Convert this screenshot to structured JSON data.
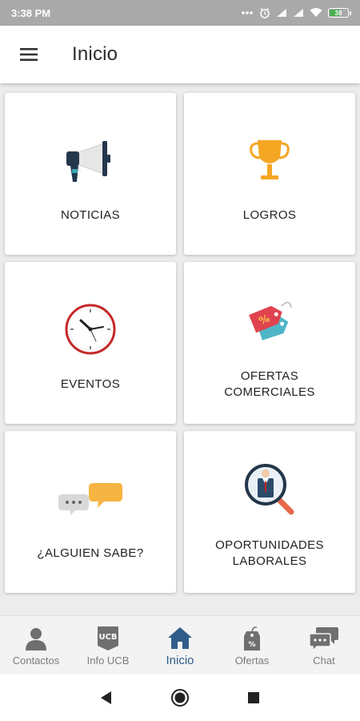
{
  "status_bar": {
    "time": "3:38 PM",
    "battery_level": "38",
    "icons": [
      "dots-icon",
      "alarm-icon",
      "signal-icon",
      "signal-icon",
      "wifi-icon",
      "battery-icon"
    ]
  },
  "app_bar": {
    "title": "Inicio",
    "menu_icon": "hamburger-menu-icon"
  },
  "cards": [
    {
      "label": "NOTICIAS",
      "icon": "megaphone-icon"
    },
    {
      "label": "LOGROS",
      "icon": "trophy-icon"
    },
    {
      "label": "EVENTOS",
      "icon": "clock-icon"
    },
    {
      "label": "OFERTAS\nCOMERCIALES",
      "icon": "price-tag-icon"
    },
    {
      "label": "¿ALGUIEN SABE?",
      "icon": "chat-bubbles-icon"
    },
    {
      "label": "OPORTUNIDADES\nLABORALES",
      "icon": "job-search-icon"
    }
  ],
  "bottom_nav": {
    "items": [
      {
        "label": "Contactos",
        "icon": "person-icon",
        "active": false
      },
      {
        "label": "Info UCB",
        "icon": "ucb-badge-icon",
        "active": false
      },
      {
        "label": "Inicio",
        "icon": "home-icon",
        "active": true
      },
      {
        "label": "Ofertas",
        "icon": "tag-percent-icon",
        "active": false
      },
      {
        "label": "Chat",
        "icon": "chat-icon",
        "active": false
      }
    ]
  },
  "system_nav": [
    "back-icon",
    "home-circle-icon",
    "recents-icon"
  ],
  "colors": {
    "status_bar": "#a9a9a9",
    "active_nav": "#2f5d8a",
    "inactive_nav": "#7b7b7b",
    "trophy": "#f5a623",
    "tag_red": "#e0434f",
    "tag_teal": "#4fb6c7"
  }
}
